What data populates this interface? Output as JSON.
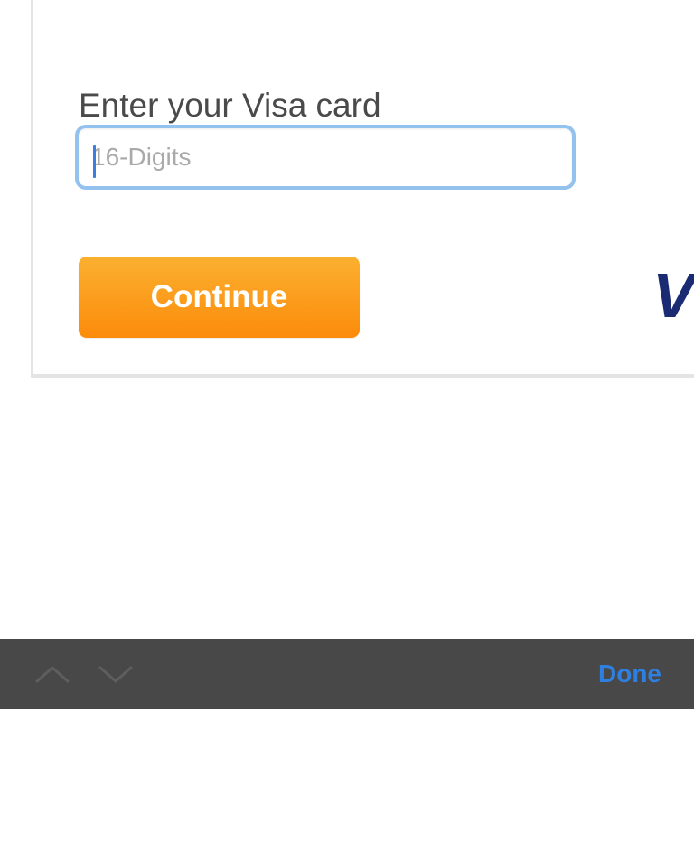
{
  "form": {
    "label": "Enter your Visa card",
    "card_input": {
      "value": "",
      "placeholder": "16-Digits"
    },
    "continue_label": "Continue",
    "visa_logo_text": "V"
  },
  "keyboard_toolbar": {
    "prev_icon": "chevron-up-icon",
    "next_icon": "chevron-down-icon",
    "done_label": "Done"
  },
  "colors": {
    "accent_blue": "#2f7fe0",
    "button_orange_top": "#fbb030",
    "button_orange_bottom": "#fc8b0b",
    "visa_blue": "#1a2a73",
    "toolbar_bg": "#484848",
    "input_focus_border": "#94c2ee"
  }
}
